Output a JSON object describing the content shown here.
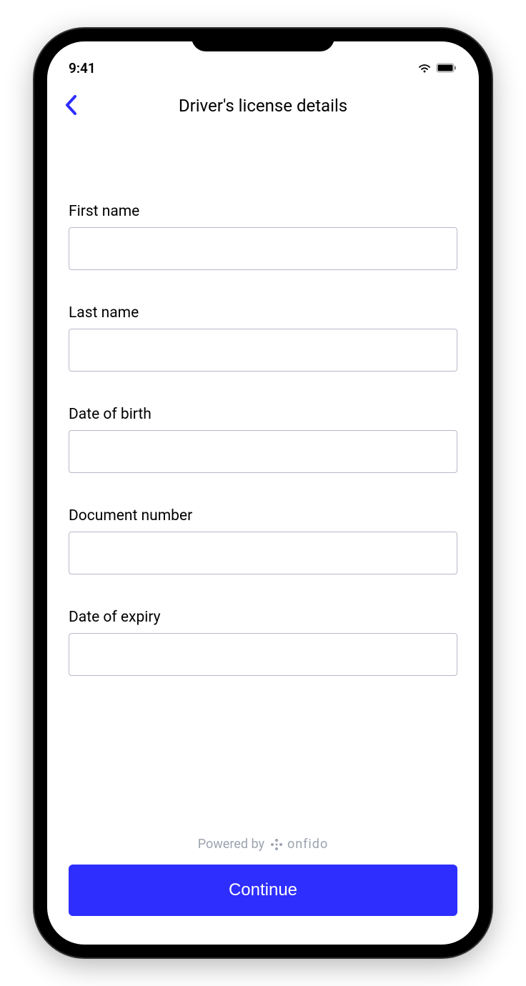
{
  "statusBar": {
    "time": "9:41"
  },
  "nav": {
    "title": "Driver's license details"
  },
  "form": {
    "fields": [
      {
        "label": "First name",
        "value": ""
      },
      {
        "label": "Last name",
        "value": ""
      },
      {
        "label": "Date of birth",
        "value": ""
      },
      {
        "label": "Document number",
        "value": ""
      },
      {
        "label": "Date of expiry",
        "value": ""
      }
    ]
  },
  "footer": {
    "poweredByText": "Powered by",
    "brandName": "onfido",
    "continueLabel": "Continue"
  }
}
